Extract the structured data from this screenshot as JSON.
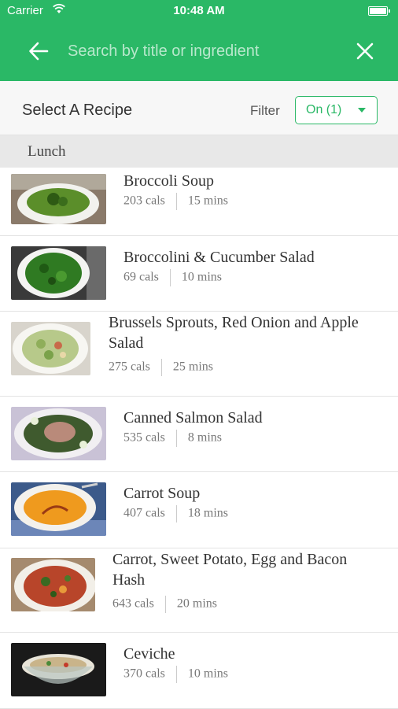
{
  "status_bar": {
    "carrier": "Carrier",
    "time": "10:48 AM"
  },
  "search": {
    "placeholder": "Search by title or ingredient",
    "value": ""
  },
  "filter_bar": {
    "title": "Select A Recipe",
    "filter_label": "Filter",
    "filter_value": "On (1)"
  },
  "section": {
    "label": "Lunch"
  },
  "recipes": [
    {
      "name": "Broccoli Soup",
      "cals": "203 cals",
      "time": "15 mins"
    },
    {
      "name": "Broccolini & Cucumber Salad",
      "cals": "69 cals",
      "time": "10 mins"
    },
    {
      "name": "Brussels Sprouts, Red Onion and Apple Salad",
      "cals": "275 cals",
      "time": "25 mins"
    },
    {
      "name": "Canned Salmon Salad",
      "cals": "535 cals",
      "time": "8 mins"
    },
    {
      "name": "Carrot Soup",
      "cals": "407 cals",
      "time": "18 mins"
    },
    {
      "name": "Carrot, Sweet Potato, Egg and Bacon Hash",
      "cals": "643 cals",
      "time": "20 mins"
    },
    {
      "name": "Ceviche",
      "cals": "370 cals",
      "time": "10 mins"
    }
  ],
  "colors": {
    "accent": "#2ab866",
    "header_bg": "#f7f7f7",
    "section_bg": "#e8e8e8"
  }
}
